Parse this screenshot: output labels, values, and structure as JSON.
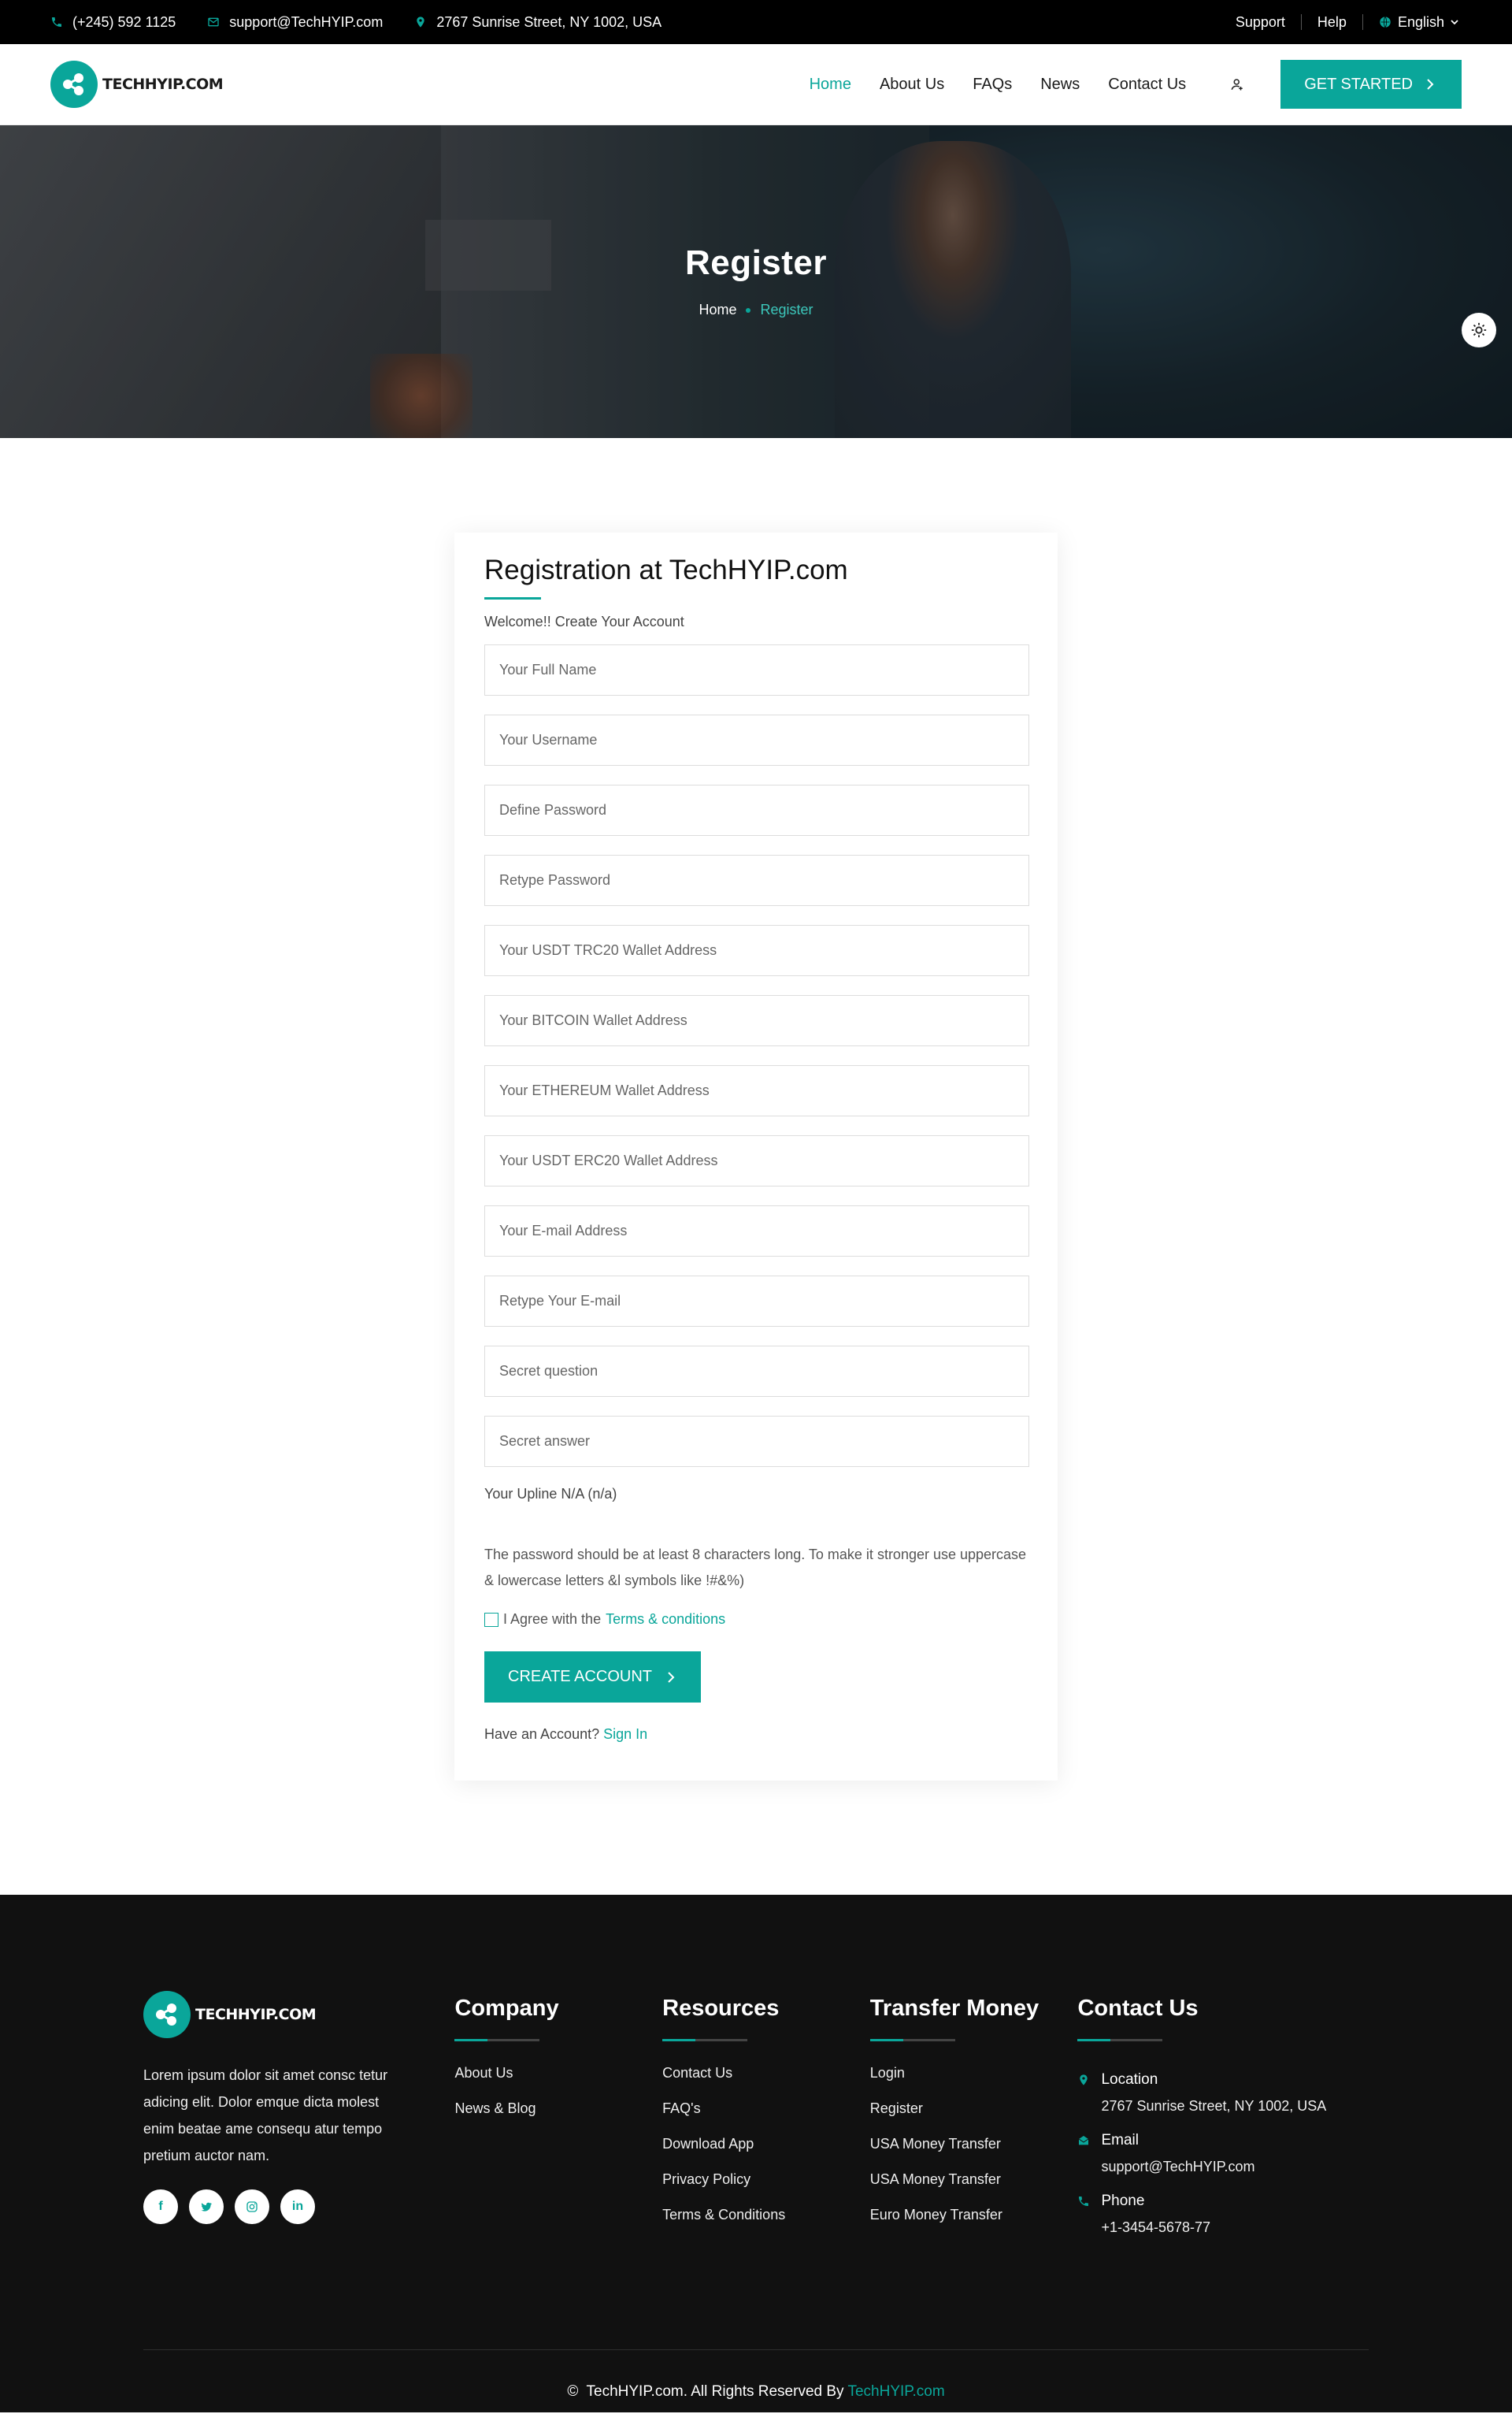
{
  "topbar": {
    "phone": "(+245) 592 1125",
    "email": "support@TechHYIP.com",
    "address": "2767 Sunrise Street, NY 1002, USA",
    "support": "Support",
    "help": "Help",
    "language": "English"
  },
  "header": {
    "logo_text": "TECHHYIP.COM",
    "nav": [
      "Home",
      "About Us",
      "FAQs",
      "News",
      "Contact Us"
    ],
    "cta": "GET STARTED"
  },
  "hero": {
    "title": "Register",
    "crumb_home": "Home",
    "crumb_current": "Register"
  },
  "form": {
    "title": "Registration at TechHYIP.com",
    "welcome": "Welcome!! Create Your Account",
    "placeholders": [
      "Your Full Name",
      "Your Username",
      "Define Password",
      "Retype Password",
      "Your USDT TRC20 Wallet Address",
      "Your BITCOIN Wallet Address",
      "Your ETHEREUM Wallet Address",
      "Your USDT ERC20 Wallet Address",
      "Your E-mail Address",
      "Retype Your E-mail",
      "Secret question",
      "Secret answer"
    ],
    "upline": "Your Upline N/A (n/a)",
    "password_note": "The password should be at least 8 characters long. To make it stronger use uppercase & lowercase letters &l symbols like !#&%)",
    "agree_text": "I Agree with the",
    "terms_link": "Terms & conditions",
    "submit": "CREATE ACCOUNT",
    "have_account": "Have an Account?",
    "sign_in": "Sign In"
  },
  "footer": {
    "logo_text": "TECHHYIP.COM",
    "about": "Lorem ipsum dolor sit amet consc tetur adicing elit. Dolor emque dicta molest enim beatae ame consequ atur tempo pretium auctor nam.",
    "socials": [
      "facebook-icon",
      "twitter-icon",
      "instagram-icon",
      "linkedin-icon"
    ],
    "company": {
      "title": "Company",
      "links": [
        "About Us",
        "News & Blog"
      ]
    },
    "resources": {
      "title": "Resources",
      "links": [
        "Contact Us",
        "FAQ's",
        "Download App",
        "Privacy Policy",
        "Terms & Conditions"
      ]
    },
    "transfer": {
      "title": "Transfer Money",
      "links": [
        "Login",
        "Register",
        "USA Money Transfer",
        "USA Money Transfer",
        "Euro Money Transfer"
      ]
    },
    "contact": {
      "title": "Contact Us",
      "location_label": "Location",
      "location": "2767 Sunrise Street, NY 1002, USA",
      "email_label": "Email",
      "email": "support@TechHYIP.com",
      "phone_label": "Phone",
      "phone": "+1-3454-5678-77"
    },
    "copyright_prefix": "TechHYIP.com. All Rights Reserved By",
    "copyright_link": "TechHYIP.com"
  },
  "colors": {
    "accent": "#0aa69a",
    "topbar": "#000000",
    "footer": "#111111"
  }
}
